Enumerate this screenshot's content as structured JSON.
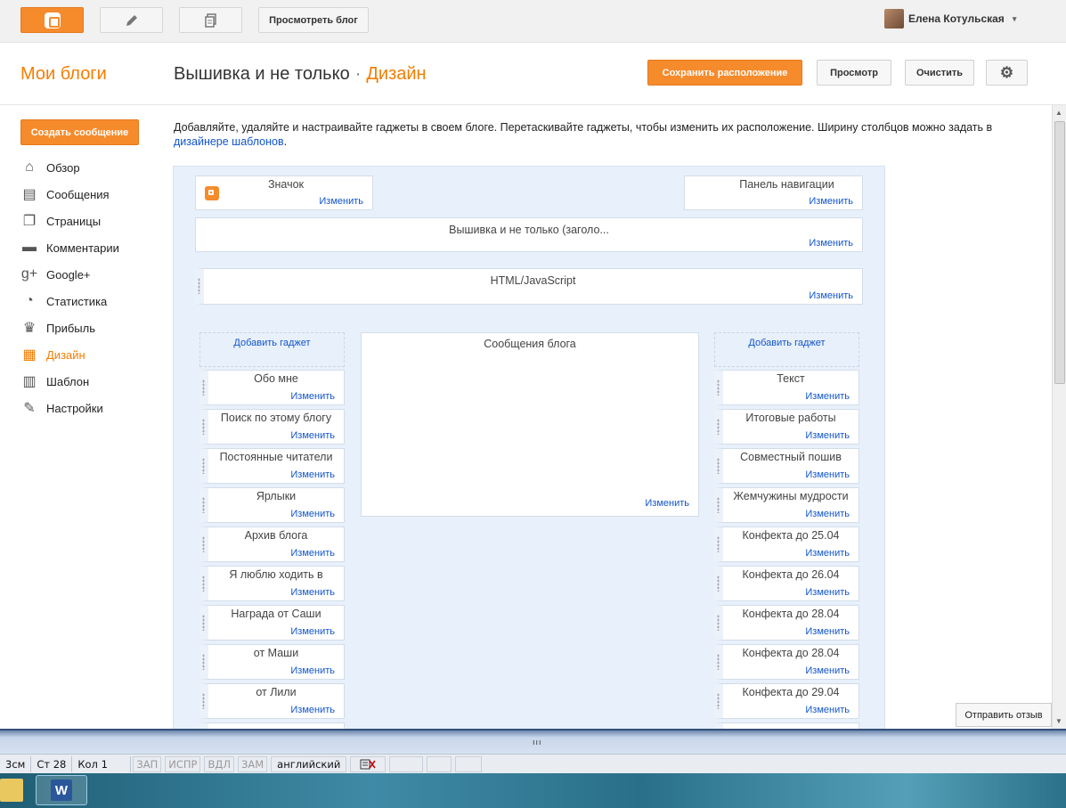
{
  "topbar": {
    "blogger_icon": "blogger-logo",
    "pencil_icon": "pencil-icon",
    "pages_icon": "pages-icon",
    "view_blog_label": "Просмотреть блог",
    "user_name": "Елена Котульская",
    "caret": "▾"
  },
  "header": {
    "my_blogs": "Мои блоги",
    "blog_name": "Вышивка и не только",
    "separator": "·",
    "section": "Дизайн",
    "save_layout_label": "Сохранить расположение",
    "preview_label": "Просмотр",
    "clear_label": "Очистить",
    "settings_icon": "⚙"
  },
  "sidebar": {
    "create_post_label": "Создать сообщение",
    "items": [
      {
        "label": "Обзор",
        "icon": "⌂",
        "active": false
      },
      {
        "label": "Сообщения",
        "icon": "▤",
        "active": false
      },
      {
        "label": "Страницы",
        "icon": "❐",
        "active": false
      },
      {
        "label": "Комментарии",
        "icon": "▬",
        "active": false
      },
      {
        "label": "Google+",
        "icon": "g+",
        "active": false
      },
      {
        "label": "Статистика",
        "icon": "◔",
        "active": false
      },
      {
        "label": "Прибыль",
        "icon": "♛",
        "active": false
      },
      {
        "label": "Дизайн",
        "icon": "▦",
        "active": true
      },
      {
        "label": "Шаблон",
        "icon": "▥",
        "active": false
      },
      {
        "label": "Настройки",
        "icon": "✎",
        "active": false
      }
    ],
    "active_color": "#f57d00"
  },
  "main": {
    "intro_text": "Добавляйте, удаляйте и настраивайте гаджеты в своем блоге. Перетаскивайте гаджеты, чтобы изменить их расположение. Ширину столбцов можно задать в ",
    "intro_link": "дизайнере шаблонов",
    "intro_end": ".",
    "edit_label": "Изменить",
    "add_gadget_label": "Добавить гаджет",
    "favicon_title": "Значок",
    "navbar_title": "Панель навигации",
    "header_title": "Вышивка и не только (заголо...",
    "html_title": "HTML/JavaScript",
    "posts_title": "Сообщения блога",
    "left_gadgets": [
      "Обо мне",
      "Поиск по этому блогу",
      "Постоянные читатели",
      "Ярлыки",
      "Архив блога",
      "Я люблю ходить в",
      "Награда от Саши",
      "от Маши",
      "от Лили"
    ],
    "right_gadgets": [
      "Текст",
      "Итоговые работы",
      "Совместный пошив",
      "Жемчужины мудрости",
      "Конфекта до 25.04",
      "Конфекта до 26.04",
      "Конфекта до 28.04",
      "Конфекта до 28.04",
      "Конфекта до 29.04"
    ]
  },
  "feedback_label": "Отправить отзыв",
  "word_status": {
    "grip": "ııı",
    "page": "3см",
    "line": "Ст  28",
    "col": "Кол  1",
    "rec": "ЗАП",
    "track": "ИСПР",
    "ext": "ВДЛ",
    "ovr": "ЗАМ",
    "lang": "английский",
    "spell_icon": "spellcheck-icon"
  },
  "taskbar": {
    "word_letter": "W"
  },
  "colors": {
    "accent": "#f68b2c",
    "link": "#1155cc",
    "layout_bg": "#e8f0fb"
  }
}
